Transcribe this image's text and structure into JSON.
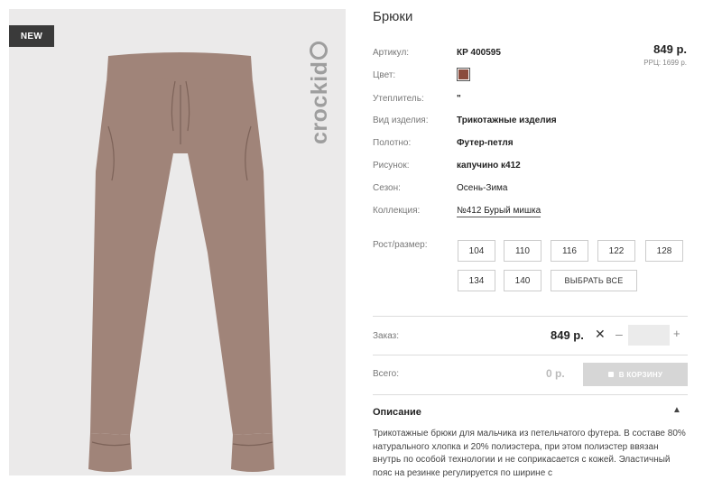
{
  "product": {
    "badge": "NEW",
    "brand": "crockid",
    "title": "Брюки",
    "price": "849 р.",
    "rrp": "РРЦ: 1699 р.",
    "color_hex": "#8a4b3c",
    "pants_color": "#a08479"
  },
  "attributes": [
    {
      "label": "Артикул:",
      "value": "КР 400595"
    },
    {
      "label": "Цвет:",
      "value": ""
    },
    {
      "label": "Утеплитель:",
      "value": "\""
    },
    {
      "label": "Вид изделия:",
      "value": "Трикотажные изделия"
    },
    {
      "label": "Полотно:",
      "value": "Футер-петля"
    },
    {
      "label": "Рисунок:",
      "value": "капучино к412"
    },
    {
      "label": "Сезон:",
      "value": "Осень-Зима"
    },
    {
      "label": "Коллекция:",
      "value": "№412 Бурый мишка"
    }
  ],
  "sizes": {
    "label": "Рост/размер:",
    "options": [
      "104",
      "110",
      "116",
      "122",
      "128",
      "134",
      "140"
    ],
    "select_all": "ВЫБРАТЬ ВСЕ"
  },
  "order": {
    "label": "Заказ:",
    "price": "849 р.",
    "times": "✕",
    "minus": "–",
    "plus": "+",
    "quantity": ""
  },
  "total": {
    "label": "Всего:",
    "value": "0 р.",
    "cart_button": "В КОРЗИНУ"
  },
  "description": {
    "heading": "Описание",
    "chevron": "▲",
    "text": "Трикотажные брюки для мальчика из петельчатого футера. В составе 80% натурального хлопка и 20% полиэстера, при этом полиэстер ввязан внутрь по особой технологии и не соприкасается с кожей. Эластичный пояс на резинке регулируется по ширине с"
  }
}
